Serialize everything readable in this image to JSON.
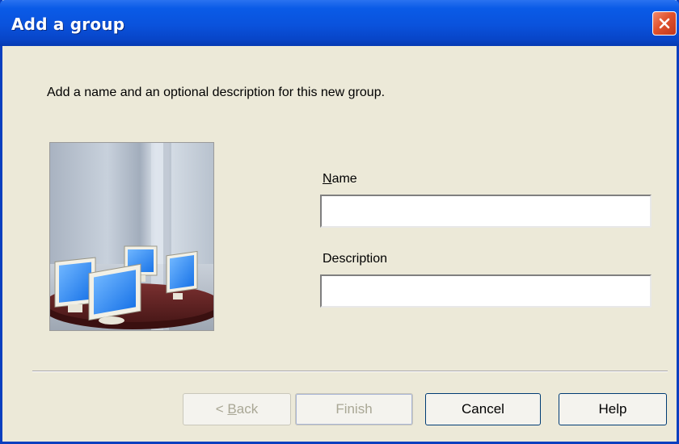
{
  "window": {
    "title": "Add a group"
  },
  "content": {
    "instruction": "Add a name and an optional description for this new group.",
    "name_label": "Name",
    "name_accel": "N",
    "name_rest": "ame",
    "name_value": "",
    "description_label": "Description",
    "description_value": ""
  },
  "buttons": {
    "back_prefix": "< ",
    "back_accel": "B",
    "back_rest": "ack",
    "back_label": "< Back",
    "finish_label": "Finish",
    "cancel_label": "Cancel",
    "help_label": "Help"
  },
  "icons": {
    "close": "close-icon",
    "illustration": "group-computers-illustration"
  },
  "colors": {
    "titlebar": "#0a52dc",
    "dialog_bg": "#ece9d8",
    "close_button": "#e0522d",
    "disabled_text": "#a9a795"
  }
}
